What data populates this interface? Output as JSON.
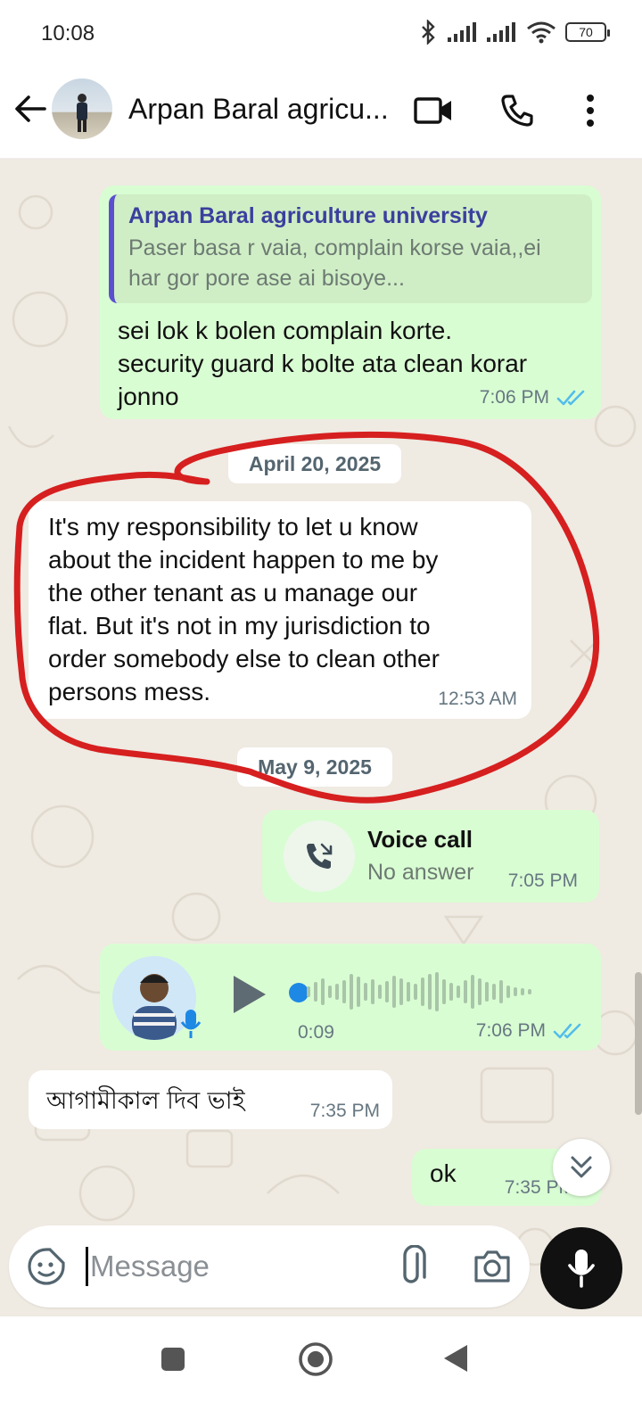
{
  "status_bar": {
    "time": "10:08",
    "battery": "70"
  },
  "header": {
    "contact_name": "Arpan Baral agricu..."
  },
  "messages": {
    "m1": {
      "quote_name": "Arpan Baral agriculture university",
      "quote_line1": "Paser basa r vaia, complain korse vaia,,ei",
      "quote_line2": "har gor pore ase ai bisoye...",
      "line1": "sei lok k bolen complain korte.",
      "line2": "security guard k bolte ata clean korar",
      "line3": "jonno",
      "time": "7:06 PM"
    },
    "date1": "April 20, 2025",
    "m2": {
      "line1": "It's my responsibility to let u know",
      "line2": "about the incident happen to me by",
      "line3": "the other tenant as u manage our",
      "line4": "flat. But it's not in my jurisdiction to",
      "line5": "order somebody else to clean other",
      "line6": "persons mess.",
      "time": "12:53 AM"
    },
    "date2": "May 9, 2025",
    "m3": {
      "title": "Voice call",
      "subtitle": "No answer",
      "time": "7:05 PM"
    },
    "m4": {
      "duration": "0:09",
      "time": "7:06 PM"
    },
    "m5": {
      "text": "আগামীকাল দিব ভাই",
      "time": "7:35 PM"
    },
    "m6": {
      "text": "ok",
      "time": "7:35 PM"
    }
  },
  "input": {
    "placeholder": "Message"
  },
  "colors": {
    "outgoing": "#d9fdd3",
    "incoming": "#ffffff",
    "chat_bg": "#efeae2",
    "read_ticks": "#53bdeb",
    "annotation": "#d61f1f"
  },
  "icons": [
    "back-arrow-icon",
    "video-call-icon",
    "phone-icon",
    "more-vert-icon",
    "read-ticks-icon",
    "missed-call-icon",
    "play-icon",
    "mic-badge-icon",
    "scroll-down-icon",
    "sticker-icon",
    "attach-icon",
    "camera-icon",
    "mic-icon",
    "nav-recents-icon",
    "nav-home-icon",
    "nav-back-icon",
    "bluetooth-icon",
    "signal-icon",
    "wifi-icon"
  ]
}
